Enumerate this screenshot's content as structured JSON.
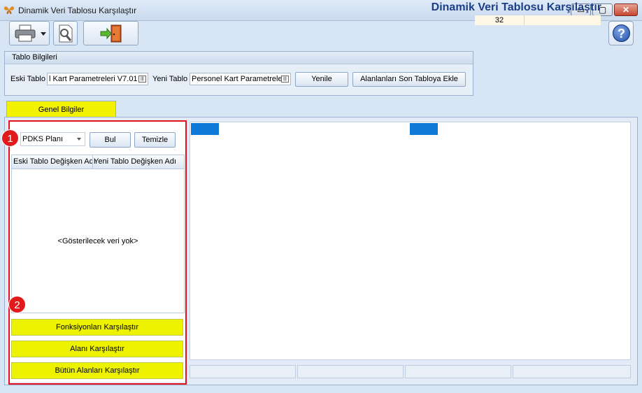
{
  "window": {
    "title": "Dinamik Veri Tablosu Karşılaştır",
    "minimize_glyph": "▭",
    "maximize_glyph": "▢",
    "close_glyph": "✕"
  },
  "header": {
    "heading": "Dinamik Veri Tablosu Karşılaştır",
    "counter": "32",
    "help_glyph": "?"
  },
  "toolbar": {
    "print_icon": "printer-icon",
    "preview_icon": "print-preview-icon",
    "exit_icon": "exit-door-icon"
  },
  "tablo_bilgileri": {
    "title": "Tablo Bilgileri",
    "eski_label": "Eski Tablo",
    "eski_value": "l Kart Parametreleri V7.01",
    "yeni_label": "Yeni Tablo",
    "yeni_value": "Personel Kart Parametrele",
    "yenile": "Yenile",
    "alanlari_ekle": "Alanlanları Son Tabloya Ekle"
  },
  "tab": {
    "label": "Genel Bilgiler"
  },
  "markers": [
    "1",
    "2"
  ],
  "filter": {
    "selected": "PDKS Planı",
    "bul": "Bul",
    "temizle": "Temizle"
  },
  "grid": {
    "columns": [
      "Eski Tablo Değişken Adı",
      "Yeni Tablo Değişken Adı"
    ],
    "empty": "<Gösterilecek veri yok>"
  },
  "actions": {
    "fonksiyonlari": "Fonksiyonları Karşılaştır",
    "alani": "Alanı Karşılaştır",
    "butun": "Bütün Alanları Karşılaştır"
  },
  "colors": {
    "accent_yellow": "#ecf200",
    "marker_red": "#e11b1b",
    "selection_blue": "#0f7ad8",
    "heading_blue": "#1b3f86"
  }
}
